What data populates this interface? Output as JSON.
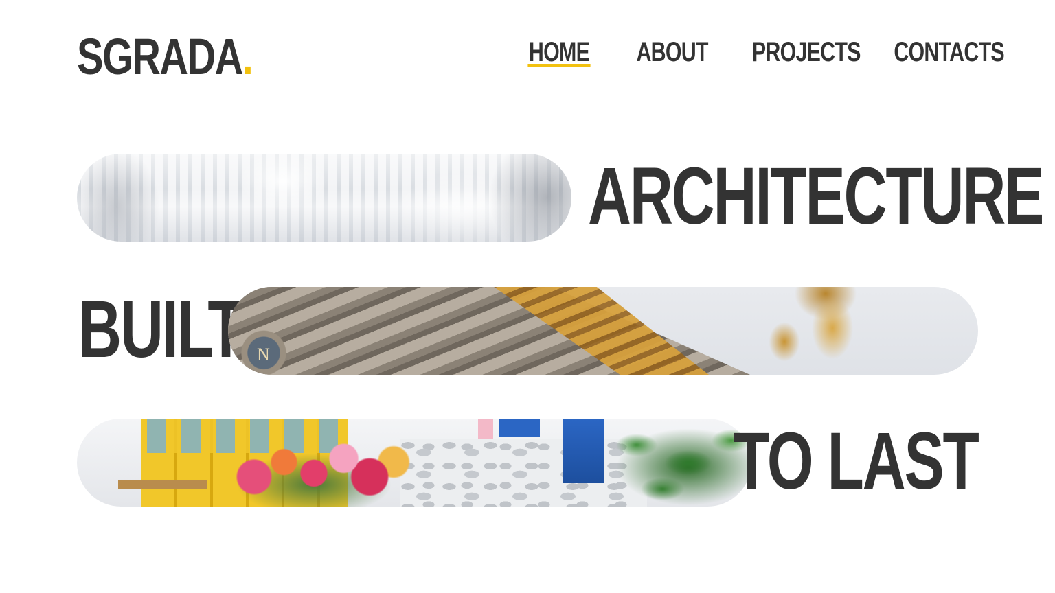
{
  "logo": {
    "text": "SGRADA",
    "dot": "."
  },
  "nav": {
    "items": [
      {
        "label": "HOME",
        "active": true
      },
      {
        "label": "ABOUT",
        "active": false
      },
      {
        "label": "PROJECTS",
        "active": false
      },
      {
        "label": "CONTACTS",
        "active": false
      }
    ]
  },
  "hero": {
    "line1": "ARCHITECTURE",
    "line2": "BUILT",
    "line3": "TO LAST",
    "emblem_letter": "N"
  },
  "colors": {
    "accent": "#f2c10f",
    "text": "#333333",
    "background": "#ffffff"
  }
}
